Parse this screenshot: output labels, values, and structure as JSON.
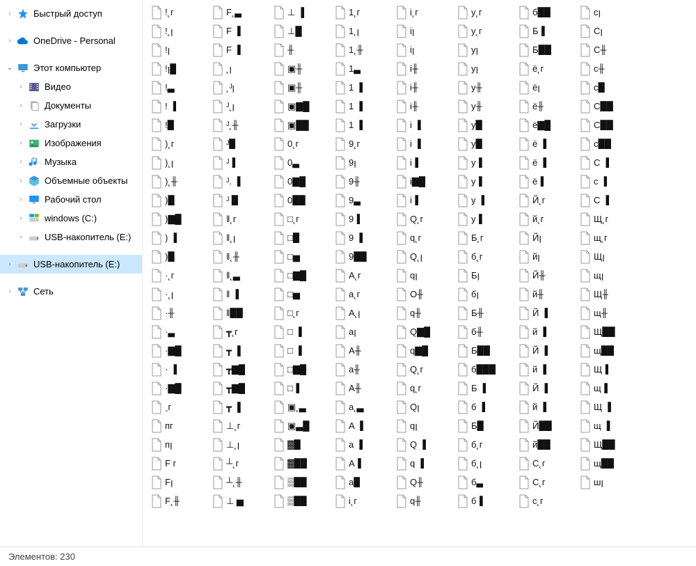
{
  "sidebar": {
    "quick_access": "Быстрый доступ",
    "onedrive": "OneDrive - Personal",
    "this_pc": "Этот компьютер",
    "video": "Видео",
    "documents": "Документы",
    "downloads": "Загрузки",
    "pictures": "Изображения",
    "music": "Музыка",
    "objects3d": "Объемные объекты",
    "desktop": "Рабочий стол",
    "windows_c": "windows (C:)",
    "usb_e1": "USB-накопитель (E:)",
    "usb_e2": "USB-накопитель (E:)",
    "network": "Сеть"
  },
  "statusbar": {
    "elements_label": "Элементов:",
    "count": "230"
  },
  "files": [
    "!˛г",
    "!˛ꞁ",
    "!ꞁ",
    "!ꞁ█",
    "!▃",
    "! ▐",
    "!█",
    ")˛г",
    ")˛ꞁ",
    ")˛╫",
    ")█",
    ")▇█",
    ") ▐",
    ")█",
    "·˛г",
    "·˛ꞁ",
    "·╫",
    "·▃",
    "·▇█",
    "· ▐",
    "·▇█",
    "ˍг",
    "ᴨг",
    "ᴨꞁ",
    "F г",
    "Fꞁ",
    "F˛╫",
    "F˛▃",
    "F ▐",
    "F ▐",
    "˛ꞁ",
    "˛ᴶꞁ",
    "ᴶ˛ꞁ",
    "ᴶ˛╫",
    "ᴶ█",
    "ᴶ▐",
    "ᴶ. ▐",
    "ᴶ █",
    "‖˛г",
    "‖˛ꞁ",
    "‖˛╫",
    "‖˛▃",
    "‖ ▐",
    "‖██",
    "┳˛г",
    "┳ ▐",
    "┳▇█",
    "┳▇█",
    "┳ ▐",
    "⊥˛г",
    "⊥˛ꞁ",
    "┴˛г",
    "┴˛╫",
    "⊥ ▅",
    "⊥ ▐",
    "⊥█",
    "╫",
    "▣╫",
    "▣╫",
    "▣▇█",
    "▣██",
    "0˛г",
    "0▃",
    "0▇█",
    "0██",
    "□˛г",
    "□█",
    "□▅",
    "□▇█",
    "□▅",
    "□˛г",
    "□ ▐",
    "□ ▐",
    "□▇█",
    "□▐",
    "▣˛▃",
    "▣▃█",
    "▓█",
    "▓██",
    "▒██",
    "▒██",
    "1˛г",
    "1˛ꞁ",
    "1˛╫",
    "1▃",
    "1 ▐",
    "1 ▐",
    "1 ▐",
    "9˛г",
    "9ꞁ",
    "9╫",
    "9▃",
    "9▐",
    "9 ▐",
    "9██",
    "A˛г",
    "a˛г",
    "A˛ꞁ",
    "aꞁ",
    "A╫",
    "a╫",
    "A╫",
    "a˛▃",
    "A ▐",
    "a ▐",
    "A▐",
    "a█",
    "i˛г",
    "і˛г",
    "iꞁ",
    "iꞁ",
    "i╫",
    "i╫",
    "і╫",
    "i ▐",
    "i ▐",
    "i▐",
    "i▇█",
    "i▐",
    "Q˛г",
    "q˛г",
    "Q˛ꞁ",
    "qꞁ",
    "O╫",
    "q╫",
    "Q▇█",
    "q▇█",
    "Q˛г",
    "q˛г",
    "Qꞁ",
    "qꞁ",
    "Q ▐",
    "q ▐",
    "Q╫",
    "q╫",
    "y˛г",
    "у˛г",
    "yꞁ",
    "уꞁ",
    "y╫",
    "у╫",
    "y█",
    "у█",
    "y▐",
    "у▐",
    "y ▐",
    "y▐",
    "Б˛г",
    "б˛г",
    "Бꞁ",
    "бꞁ",
    "Б╫",
    "б╫",
    "Б██",
    "б███",
    "Б ▐",
    "б ▐",
    "Б█",
    "б˛г",
    "б˛ꞁ",
    "б▃",
    "б▐",
    "б██",
    "Б▐",
    "Б██",
    "ё˛г",
    "ёꞁ",
    "ё╫",
    "ё▇█",
    "ё ▐",
    "ё ▐",
    "ё▐",
    "Й˛г",
    "й˛г",
    "Йꞁ",
    "йꞁ",
    "Й╫",
    "й╫",
    "Й ▐",
    "й ▐",
    "Й ▐",
    "й ▐",
    "Й ▐",
    "й ▐",
    "Й██",
    "й██",
    "C˛г",
    "С˛г",
    "c˛г",
    "cꞁ",
    "Cꞁ",
    "C╫",
    "c╫",
    "с█",
    "С██",
    "C██",
    "c██",
    "С ▐",
    "с ▐",
    "C ▐",
    "Щ˛г",
    "щ˛г",
    "Щꞁ",
    "щꞁ",
    "Щ╫",
    "щ╫",
    "Щ██",
    "щ██",
    "Щ▐",
    "щ▐",
    "Щ ▐",
    "щ ▐",
    "Щ██",
    "щ██",
    "шꞁ"
  ]
}
